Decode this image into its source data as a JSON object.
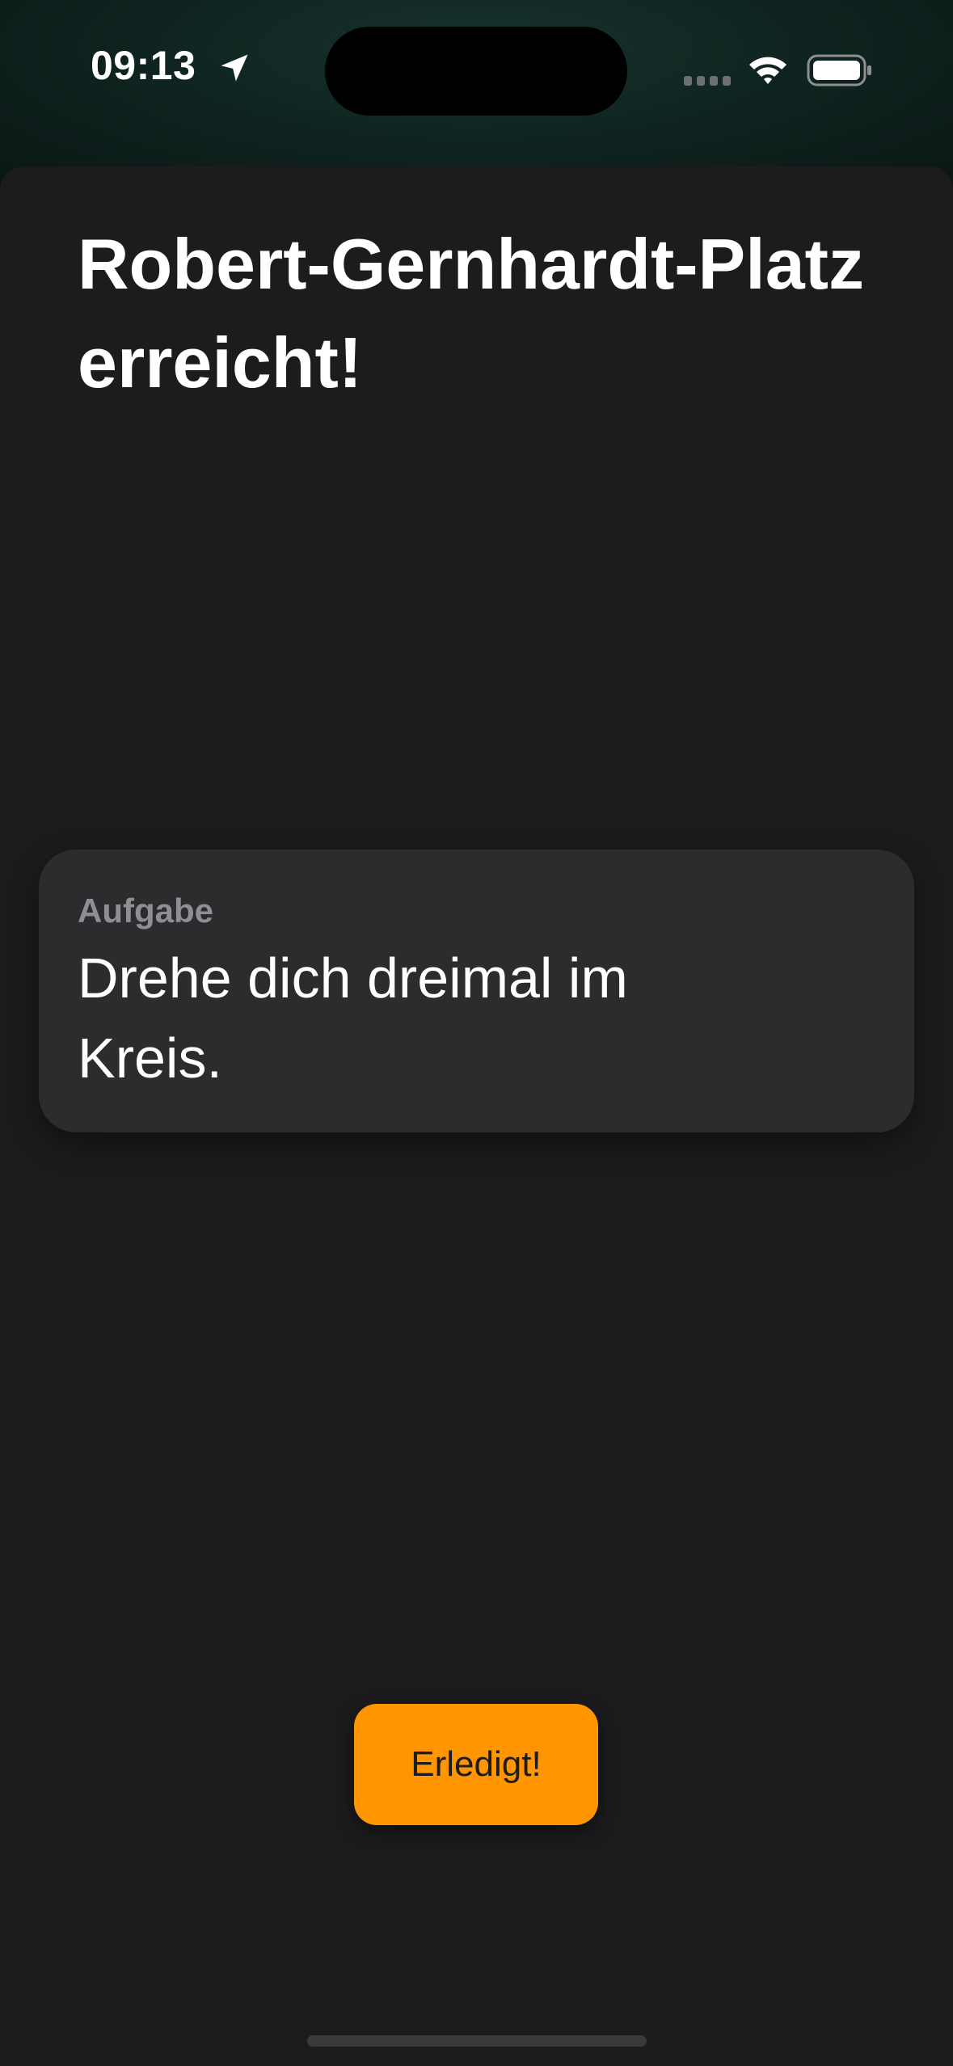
{
  "status_bar": {
    "time": "09:13",
    "location_icon": "location-arrow-icon",
    "signal_icon": "cellular-signal-icon",
    "wifi_icon": "wifi-icon",
    "battery_icon": "battery-icon"
  },
  "screen": {
    "title": "Robert-Gernhardt-Platz erreicht!",
    "task_card": {
      "label": "Aufgabe",
      "text": "Drehe dich dreimal im Kreis."
    },
    "done_button_label": "Erledigt!"
  },
  "colors": {
    "accent": "#ff9500",
    "background": "#1c1c1e",
    "card": "#2c2c2e",
    "secondary_text": "#8e8e93"
  }
}
